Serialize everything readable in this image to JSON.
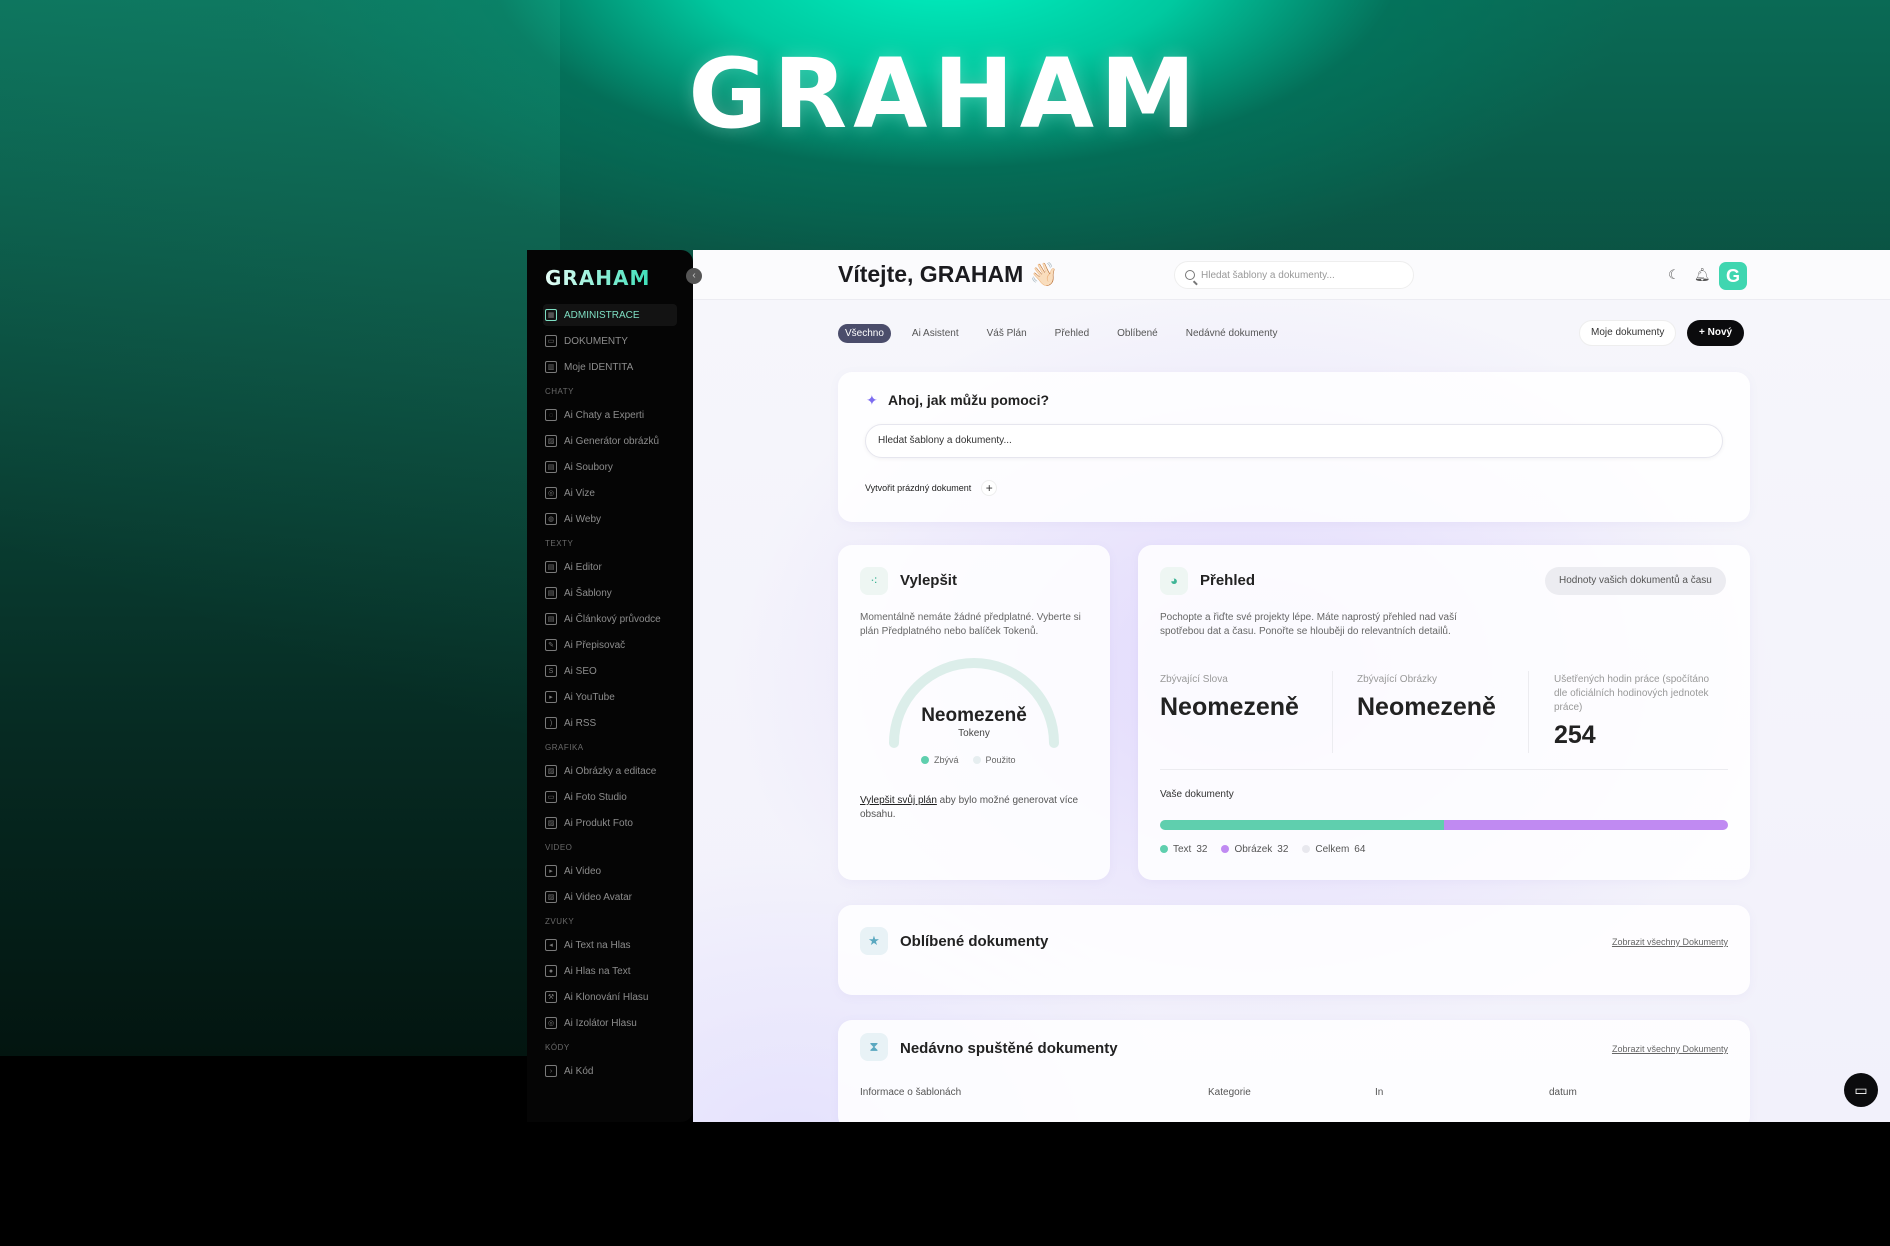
{
  "hero": {
    "logo": "GRAHAM"
  },
  "sidebar": {
    "logo": "GRAHAM",
    "collapse_icon": "chevron-left-icon",
    "entries": [
      {
        "kind": "item",
        "label": "ADMINISTRACE",
        "icon": "grid-icon",
        "active": true
      },
      {
        "kind": "item",
        "label": "DOKUMENTY",
        "icon": "archive-icon"
      },
      {
        "kind": "item",
        "label": "Moje IDENTITA",
        "icon": "book-icon"
      },
      {
        "kind": "section",
        "label": "CHATY"
      },
      {
        "kind": "item",
        "label": "Ai Chaty a Experti",
        "icon": "chat-icon"
      },
      {
        "kind": "item",
        "label": "Ai Generátor obrázků",
        "icon": "image-icon"
      },
      {
        "kind": "item",
        "label": "Ai Soubory",
        "icon": "file-icon"
      },
      {
        "kind": "item",
        "label": "Ai Vize",
        "icon": "scan-icon"
      },
      {
        "kind": "item",
        "label": "Ai Weby",
        "icon": "globe-icon"
      },
      {
        "kind": "section",
        "label": "TEXTY"
      },
      {
        "kind": "item",
        "label": "Ai Editor",
        "icon": "document-icon"
      },
      {
        "kind": "item",
        "label": "Ai Šablony",
        "icon": "template-icon"
      },
      {
        "kind": "item",
        "label": "Ai Článkový průvodce",
        "icon": "article-icon"
      },
      {
        "kind": "item",
        "label": "Ai Přepisovač",
        "icon": "pen-icon"
      },
      {
        "kind": "item",
        "label": "Ai SEO",
        "icon": "seo-icon"
      },
      {
        "kind": "item",
        "label": "Ai YouTube",
        "icon": "play-icon"
      },
      {
        "kind": "item",
        "label": "Ai RSS",
        "icon": "rss-icon"
      },
      {
        "kind": "section",
        "label": "GRAFIKA"
      },
      {
        "kind": "item",
        "label": "Ai Obrázky a editace",
        "icon": "image-edit-icon"
      },
      {
        "kind": "item",
        "label": "Ai Foto Studio",
        "icon": "laptop-icon"
      },
      {
        "kind": "item",
        "label": "Ai Produkt Foto",
        "icon": "product-photo-icon"
      },
      {
        "kind": "section",
        "label": "VIDEO"
      },
      {
        "kind": "item",
        "label": "Ai Video",
        "icon": "video-icon"
      },
      {
        "kind": "item",
        "label": "Ai Video Avatar",
        "icon": "avatar-video-icon"
      },
      {
        "kind": "section",
        "label": "ZVUKY"
      },
      {
        "kind": "item",
        "label": "Ai Text na Hlas",
        "icon": "speaker-icon"
      },
      {
        "kind": "item",
        "label": "Ai Hlas na Text",
        "icon": "microphone-icon"
      },
      {
        "kind": "item",
        "label": "Ai Klonování Hlasu",
        "icon": "wrench-icon"
      },
      {
        "kind": "item",
        "label": "Ai Izolátor Hlasu",
        "icon": "isolate-icon"
      },
      {
        "kind": "section",
        "label": "KÓDY"
      },
      {
        "kind": "item",
        "label": "Ai Kód",
        "icon": "terminal-icon"
      }
    ]
  },
  "header": {
    "welcome": "Vítejte, GRAHAM 👋🏻",
    "search_placeholder": "Hledat šablony a dokumenty...",
    "theme_icon": "moon-icon",
    "bell_icon": "bell-icon",
    "avatar": "G"
  },
  "tabs": [
    "Všechno",
    "Ai Asistent",
    "Váš Plán",
    "Přehled",
    "Oblíbené",
    "Nedávné dokumenty"
  ],
  "actions": {
    "my_docs": "Moje dokumenty",
    "new": "+ Nový"
  },
  "assistant": {
    "title": "Ahoj, jak můžu pomoci?",
    "input_placeholder": "Hledat šablony a dokumenty...",
    "create_blank": "Vytvořit prázdný dokument"
  },
  "upgrade": {
    "title": "Vylepšit",
    "description": "Momentálně nemáte žádné předplatné. Vyberte si plán Předplatného nebo balíček Tokenů.",
    "gauge_value": "Neomezeně",
    "gauge_unit": "Tokeny",
    "legend_remaining": "Zbývá",
    "legend_used": "Použito",
    "link_text": "Vylepšit svůj plán",
    "link_rest": " aby bylo možné generovat více obsahu."
  },
  "overview": {
    "title": "Přehled",
    "pill": "Hodnoty vašich dokumentů a času",
    "description": "Pochopte a řiďte své projekty lépe. Máte naprostý přehled nad vaší spotřebou dat a času. Ponořte se hlouběji do relevantních detailů.",
    "stats": [
      {
        "label": "Zbývající Slova",
        "value": "Neomezeně"
      },
      {
        "label": "Zbývající Obrázky",
        "value": "Neomezeně"
      },
      {
        "label": "Ušetřených hodin práce (spočítáno dle oficiálních hodinových jednotek práce)",
        "value": "254"
      }
    ],
    "docs_title": "Vaše dokumenty",
    "docs": [
      {
        "label": "Text",
        "count": 32,
        "color": "#5fcfae"
      },
      {
        "label": "Obrázek",
        "count": 32,
        "color": "#c08af2"
      },
      {
        "label": "Celkem",
        "count": 64,
        "color": "#e8e8ee"
      }
    ],
    "colors": {
      "text": "#5fcfae",
      "image": "#c08af2"
    }
  },
  "favorites": {
    "title": "Oblíbené dokumenty",
    "link": "Zobrazit všechny Dokumenty"
  },
  "recent": {
    "title": "Nedávno spuštěné dokumenty",
    "link": "Zobrazit všechny Dokumenty",
    "columns": [
      "Informace o šablonách",
      "Kategorie",
      "In",
      "datum"
    ]
  },
  "colors": {
    "accent": "#3fd6b0",
    "active_tab": "#4b4d6b",
    "primary_button": "#0b0b0d"
  }
}
